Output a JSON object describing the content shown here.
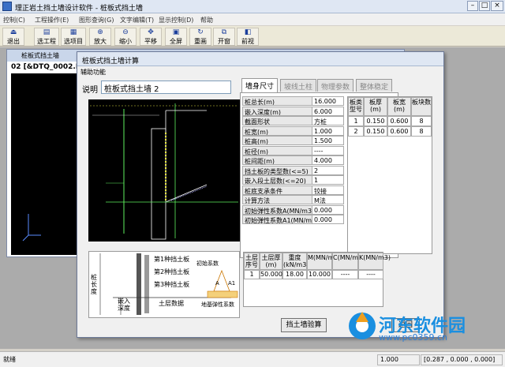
{
  "app": {
    "title": "理正岩土挡土墙设计软件 - 桩板式挡土墙"
  },
  "menu": {
    "items": [
      "控制(C)",
      "工程操作(E)",
      "图形查询(G)",
      "文字编辑(T)",
      "显示控制(D)",
      "帮助"
    ]
  },
  "toolbar": {
    "buttons": [
      "退出",
      "选工程",
      "选项目",
      "放大",
      "缩小",
      "平移",
      "全屏",
      "重画",
      "开窗",
      "前视"
    ]
  },
  "child_window": {
    "title": "桩板式挡土墙",
    "header": "02 [&DTQ_0002.D"
  },
  "dialog": {
    "title": "桩板式挡土墙计算",
    "menu_label": "辅助功能",
    "name_label": "说明",
    "name_value": "桩板式挡土墙 2",
    "tabs": [
      "墙身尺寸",
      "坡线土柱",
      "物理参数",
      "整体稳定"
    ],
    "params": [
      {
        "label": "桩总长(m)",
        "value": "16.000"
      },
      {
        "label": "嵌入深度(m)",
        "value": "6.000"
      },
      {
        "label": "截面形状",
        "value": "方桩"
      },
      {
        "label": "桩宽(m)",
        "value": "1.000"
      },
      {
        "label": "桩高(m)",
        "value": "1.500"
      },
      {
        "label": "桩径(m)",
        "value": "----"
      },
      {
        "label": "桩间距(m)",
        "value": "4.000"
      },
      {
        "label": "挡土板的类型数(<=5)",
        "value": "2"
      },
      {
        "label": "嵌入段土层数(<=20)",
        "value": "1"
      },
      {
        "label": "桩底支承条件",
        "value": "铰接"
      },
      {
        "label": "计算方法",
        "value": "M法"
      },
      {
        "label": "初始弹性系数A(MN/m3)",
        "value": "0.000"
      },
      {
        "label": "初始弹性系数A1(MN/m3)",
        "value": "0.000"
      }
    ],
    "board_table": {
      "headers": [
        "板类型号",
        "板厚(m)",
        "板宽(m)",
        "板块数"
      ],
      "rows": [
        [
          "1",
          "0.150",
          "0.600",
          "8"
        ],
        [
          "2",
          "0.150",
          "0.600",
          "8"
        ]
      ]
    },
    "soil_table": {
      "headers": [
        "土层序号",
        "土层厚(m)",
        "重度(kN/m3)",
        "M(MN/m4)",
        "C(MN/m3.5)",
        "K(MN/m3)"
      ],
      "rows": [
        [
          "1",
          "50.000",
          "18.00",
          "10.000",
          "----",
          "----"
        ]
      ]
    },
    "sketch_labels": {
      "board1": "第1种挡土板",
      "board2": "第2种挡土板",
      "board3": "第3种挡土板",
      "soil_layers": "土层数据",
      "pile_length": "桩长度",
      "embed_depth": "嵌入深度",
      "init_coef": "初始系数",
      "base_coef": "地基弹性系数",
      "a": "A",
      "a1": "A1"
    },
    "calc_button": "挡土墙验算",
    "close_button": "返回"
  },
  "status": {
    "left": "就绪",
    "zoom": "1.000",
    "coords": "[0.287 , 0.000 , 0.000]"
  },
  "watermark": {
    "text": "河东软件园",
    "url": "www.pc0359.cn"
  }
}
